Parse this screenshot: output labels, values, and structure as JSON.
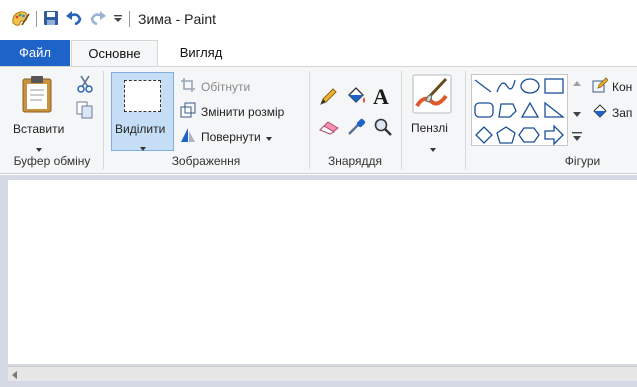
{
  "window": {
    "title": "Зима - Paint"
  },
  "tabs": [
    {
      "label": "Файл"
    },
    {
      "label": "Основне"
    },
    {
      "label": "Вигляд"
    }
  ],
  "clipboard": {
    "paste_label": "Вставити",
    "group_label": "Буфер обміну"
  },
  "image": {
    "select_label": "Виділити",
    "crop_label": "Обітнути",
    "resize_label": "Змінити розмір",
    "rotate_label": "Повернути",
    "group_label": "Зображення"
  },
  "tools": {
    "group_label": "Знаряддя"
  },
  "brushes": {
    "label": "Пензлі"
  },
  "shapes": {
    "group_label": "Фігури",
    "outline_label": "Кон",
    "fill_label": "Зап"
  },
  "colors": {
    "accent": "#1e64c8",
    "selected": "#c5def5",
    "workspace": "#d4d9e4"
  }
}
